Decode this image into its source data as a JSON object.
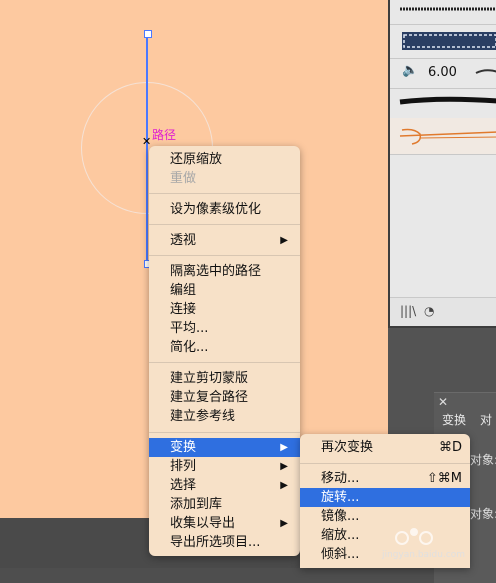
{
  "brushes_panel": {
    "brush_size": "6.00",
    "footer_icons": [
      "library-icon",
      "brush-options-icon"
    ]
  },
  "transform_panel": {
    "close": "✕",
    "tab_label": "变换",
    "tab2_label": "对",
    "row1": "对象:",
    "row2": "对象:"
  },
  "path": {
    "label": "路径"
  },
  "context_menu": {
    "items": [
      {
        "label": "还原缩放",
        "enabled": true
      },
      {
        "label": "重做",
        "enabled": false
      },
      {
        "label": "设为像素级优化",
        "enabled": true
      },
      {
        "label": "透视",
        "enabled": true,
        "submenu": true
      },
      {
        "label": "隔离选中的路径",
        "enabled": true
      },
      {
        "label": "编组",
        "enabled": true
      },
      {
        "label": "连接",
        "enabled": true
      },
      {
        "label": "平均...",
        "enabled": true
      },
      {
        "label": "简化...",
        "enabled": true
      },
      {
        "label": "建立剪切蒙版",
        "enabled": true
      },
      {
        "label": "建立复合路径",
        "enabled": true
      },
      {
        "label": "建立参考线",
        "enabled": true
      },
      {
        "label": "变换",
        "enabled": true,
        "submenu": true,
        "highlighted": true
      },
      {
        "label": "排列",
        "enabled": true,
        "submenu": true
      },
      {
        "label": "选择",
        "enabled": true,
        "submenu": true
      },
      {
        "label": "添加到库",
        "enabled": true
      },
      {
        "label": "收集以导出",
        "enabled": true,
        "submenu": true
      },
      {
        "label": "导出所选项目...",
        "enabled": true
      }
    ]
  },
  "transform_submenu": {
    "items": [
      {
        "label": "再次变换",
        "shortcut": "⌘D"
      },
      {
        "label": "移动...",
        "shortcut": "⇧⌘M"
      },
      {
        "label": "旋转...",
        "shortcut": "",
        "highlighted": true
      },
      {
        "label": "镜像...",
        "shortcut": ""
      },
      {
        "label": "缩放...",
        "shortcut": ""
      },
      {
        "label": "倾斜...",
        "shortcut": ""
      }
    ]
  },
  "watermark": {
    "text": "jingyan.baidu.com"
  },
  "colors": {
    "highlight": "#2f6fe0",
    "artboard": "#fdc9a0",
    "menu_bg": "#f7e1c8",
    "path": "#4a78ff",
    "label": "#e020d0"
  }
}
